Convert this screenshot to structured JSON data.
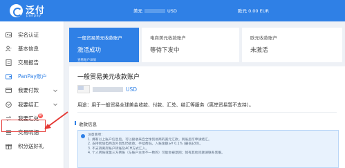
{
  "brand": {
    "name": "泛付",
    "sub": "panpay"
  },
  "header": {
    "usd_label": "美元",
    "usd_suffix": "USD",
    "eur_label": "欧元 0.00 EUR"
  },
  "sidebar": {
    "items": [
      {
        "label": "实名认证",
        "icon": "id-card-icon"
      },
      {
        "label": "基本信息",
        "icon": "user-icon"
      },
      {
        "label": "交易报告",
        "icon": "report-icon"
      },
      {
        "label": "PanPay账户",
        "icon": "wallet-icon",
        "active": true
      },
      {
        "label": "我要付款",
        "icon": "pay-icon",
        "expandable": true
      },
      {
        "label": "我要结汇",
        "icon": "exchange-icon",
        "expandable": true
      },
      {
        "label": "我要汇兑",
        "icon": "convert-icon",
        "badge": "新"
      },
      {
        "label": "交易明细",
        "icon": "list-icon"
      },
      {
        "label": "积分送好礼",
        "icon": "gift-icon"
      }
    ]
  },
  "tabs": [
    {
      "title": "一般贸易美元收款账户",
      "status": "激活成功",
      "note": "查看账户详情",
      "selected": true
    },
    {
      "title": "电商美元收款账户",
      "status": "等待下发中",
      "note": ""
    },
    {
      "title": "欧元收款账户",
      "status": "未激活",
      "note": ""
    }
  ],
  "panel": {
    "title": "一般贸易美元收款账户",
    "currency": "USD",
    "usage": "用途：用于一般贸易全球美金收款、付款、汇兑、结汇等服务（离岸贸易暂不支持）。",
    "section": "收款信息",
    "notice": [
      "注意事项：",
      "1. 拥有以上账户信息后，可以接收来自全球贸易商的美元汇款，到账后可申请结汇。",
      "2. 支持跨境电商及外贸B2B收款，手续费低。入账金额≥¥ 0.1% (最低$30)。",
      "3. 不支持离岸账户转账及ACH方式汇入。",
      "4. 个人转账或第三方转账（与账户主体不一致的）可能会被退回；如有其他问题请联系客服。"
    ]
  },
  "colors": {
    "primary": "#2f80e6",
    "highlight": "#e53935",
    "badge": "#f5504b"
  }
}
